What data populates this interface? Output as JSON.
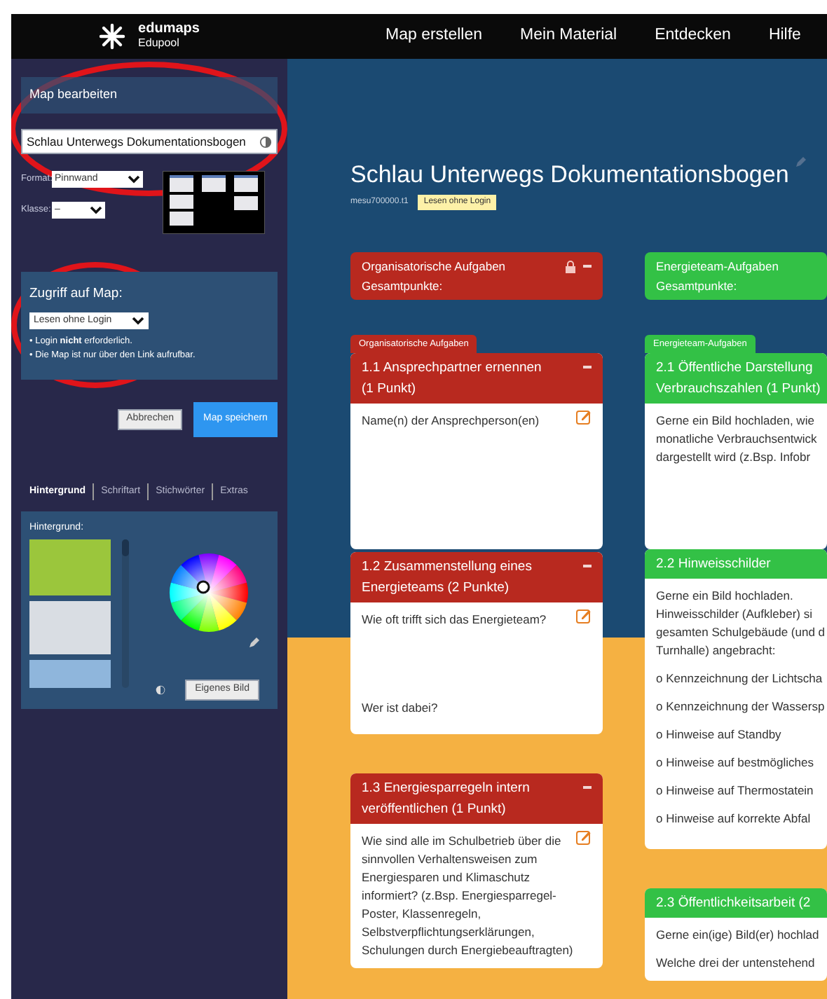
{
  "header": {
    "logo": {
      "name": "edumaps",
      "sub": "Edupool"
    },
    "nav": [
      {
        "label": "Map erstellen"
      },
      {
        "label": "Mein Material"
      },
      {
        "label": "Entdecken"
      },
      {
        "label": "Hilfe"
      }
    ]
  },
  "sidebar": {
    "panel_title": "Map bearbeiten",
    "map_name": "Schlau Unterwegs Dokumentationsbogen",
    "format": {
      "label": "Format:",
      "value": "Pinnwand"
    },
    "klasse": {
      "label": "Klasse:",
      "value": "–"
    },
    "access": {
      "title": "Zugriff auf Map:",
      "value": "Lesen ohne Login",
      "notes": [
        "• Login **nicht** erforderlich.",
        "• Die Map ist nur über den Link aufrufbar."
      ]
    },
    "buttons": [
      {
        "label": "Abbrechen",
        "kind": "secondary"
      },
      {
        "label": "Map speichern",
        "kind": "primary"
      }
    ],
    "tabs": [
      {
        "label": "Hintergrund",
        "selected": true
      },
      {
        "label": "Schriftart",
        "selected": false
      },
      {
        "label": "Stichwörter",
        "selected": false
      },
      {
        "label": "Extras",
        "selected": false
      }
    ],
    "background": {
      "title": "Hintergrund:",
      "upload": "Eigenes Bild"
    }
  },
  "map": {
    "title": "Schlau Unterwegs Dokumentationsbogen",
    "code": "mesu700000.t1",
    "access_badge": "Lesen ohne Login",
    "columns": [
      {
        "color": "#b8291f",
        "header": [
          "Organisatorische Aufgaben",
          "Gesamtpunkte:"
        ],
        "locked": true,
        "tab": "Organisatorische Aufgaben",
        "cards": [
          {
            "title": [
              "1.1 Ansprechpartner ernennen",
              "(1 Punkt)"
            ],
            "editable": true,
            "body": [
              "Name(n) der Ansprechperson(en)"
            ]
          },
          {
            "title": [
              "1.2 Zusammenstellung eines",
              "Energieteams (2 Punkte)"
            ],
            "editable": true,
            "body": [
              "Wie oft trifft sich das Energieteam?",
              "Wer ist dabei?"
            ]
          },
          {
            "title": [
              "1.3 Energiesparregeln intern",
              "veröffentlichen (1 Punkt)"
            ],
            "editable": true,
            "body": [
              "Wie sind alle im Schulbetrieb über die",
              "sinnvollen Verhaltensweisen zum",
              "Energiesparen und Klimaschutz",
              "informiert? (z.Bsp. Energiesparregel-",
              "Poster, Klassenregeln,",
              "Selbstverpflichtungserklärungen,",
              "Schulungen durch Energiebeauftragten)"
            ]
          }
        ]
      },
      {
        "color": "#33c146",
        "header": [
          "Energieteam-Aufgaben",
          "Gesamtpunkte:"
        ],
        "locked": false,
        "tab": "Energieteam-Aufgaben",
        "cards": [
          {
            "title": [
              "2.1 Öffentliche Darstellung",
              "Verbrauchszahlen (1 Punkt)"
            ],
            "editable": false,
            "body": [
              "Gerne ein Bild hochladen, wie",
              "monatliche Verbrauchsentwick",
              "dargestellt wird (z.Bsp. Infobr"
            ]
          },
          {
            "title": [
              "2.2 Hinweisschilder"
            ],
            "editable": false,
            "body": [
              "Gerne ein Bild hochladen.",
              "Hinweisschilder (Aufkleber) si",
              "gesamten Schulgebäude (und d",
              "Turnhalle) angebracht:",
              "o Kennzeichnung der Lichtscha",
              "o Kennzeichnung der Wassersp",
              "o Hinweise auf Standby",
              "o Hinweise auf bestmögliches",
              "o Hinweise auf Thermostatein",
              "o Hinweise auf korrekte Abfal"
            ]
          },
          {
            "title": [
              "2.3 Öffentlichkeitsarbeit (2"
            ],
            "editable": false,
            "body": [
              "Gerne ein(ige) Bild(er) hochlad",
              "Welche drei der untenstehend"
            ]
          }
        ]
      }
    ]
  }
}
